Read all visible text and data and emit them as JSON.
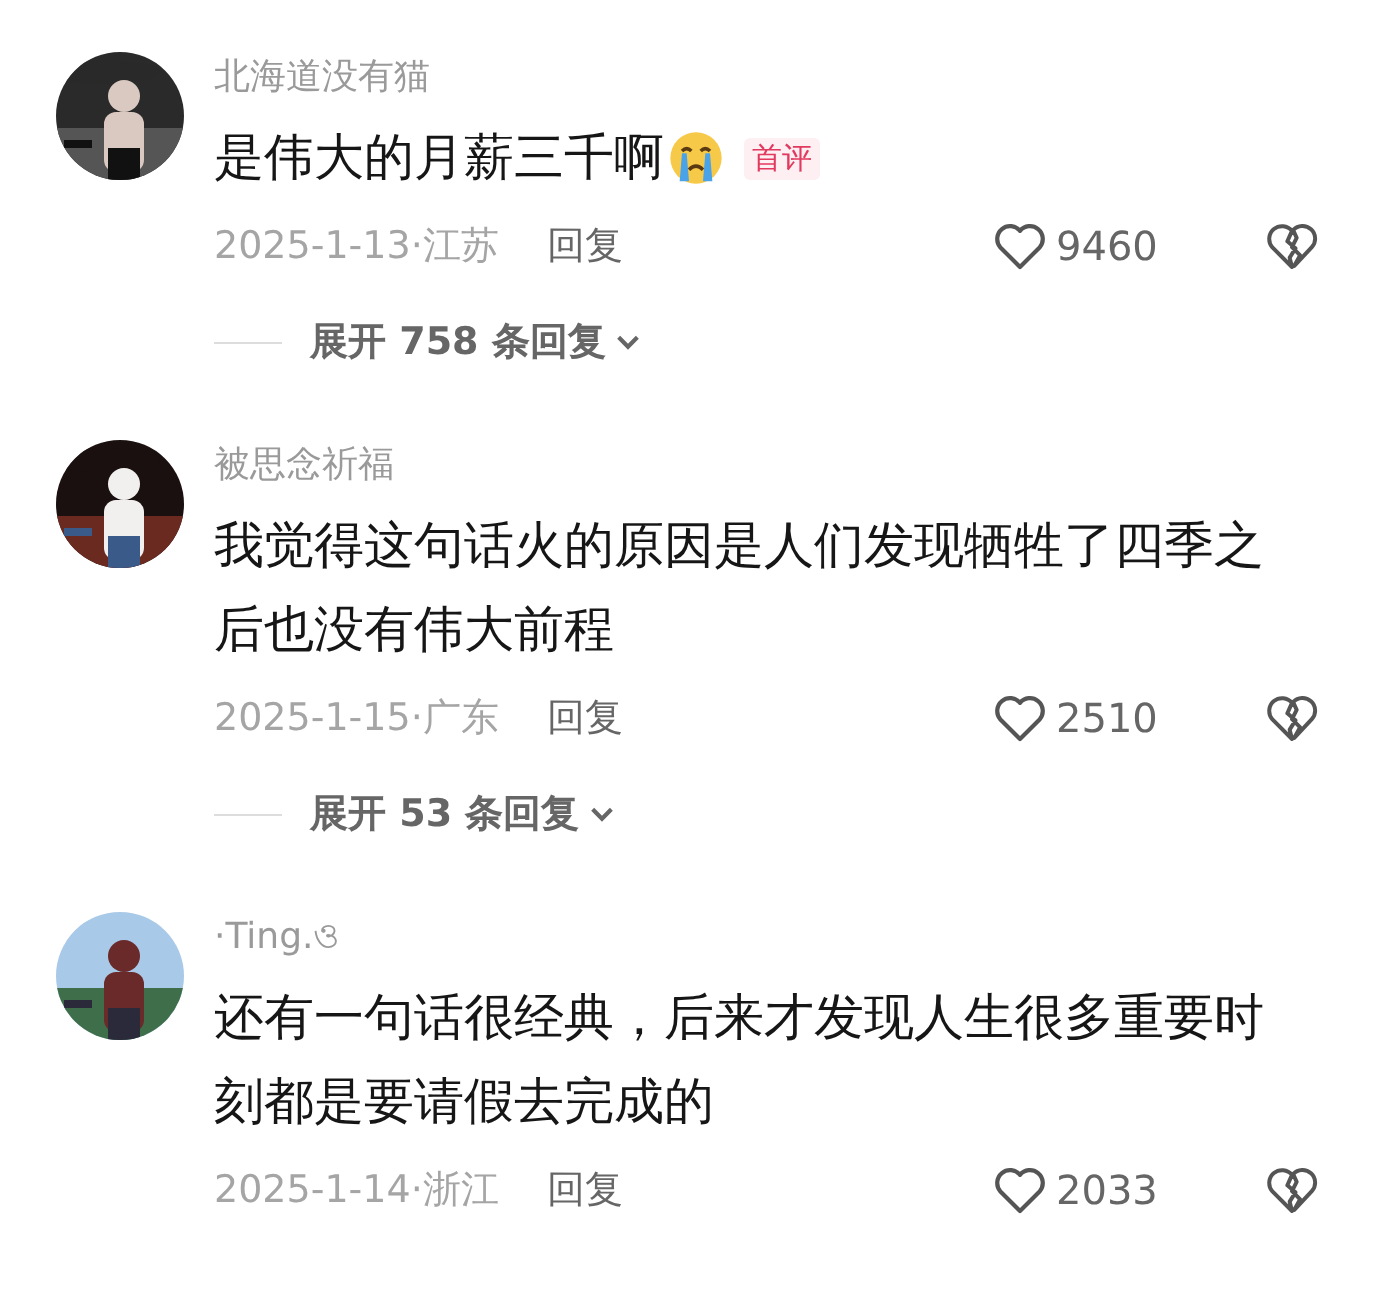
{
  "comments": [
    {
      "username": "北海道没有猫",
      "text": "是伟大的月薪三千啊",
      "emoji": true,
      "badge": "首评",
      "date_location": "2025-1-13·江苏",
      "reply": "回复",
      "likes": "9460",
      "expand": "展开 758 条回复"
    },
    {
      "username": "被思念祈福",
      "text": "我觉得这句话火的原因是人们发现牺牲了四季之后也没有伟大前程",
      "emoji": false,
      "date_location": "2025-1-15·广东",
      "reply": "回复",
      "likes": "2510",
      "expand": "展开 53 条回复"
    },
    {
      "username": "·Ting.ও",
      "text": "还有一句话很经典，后来才发现人生很多重要时刻都是要请假去完成的",
      "emoji": false,
      "date_location": "2025-1-14·浙江",
      "reply": "回复",
      "likes": "2033"
    }
  ]
}
